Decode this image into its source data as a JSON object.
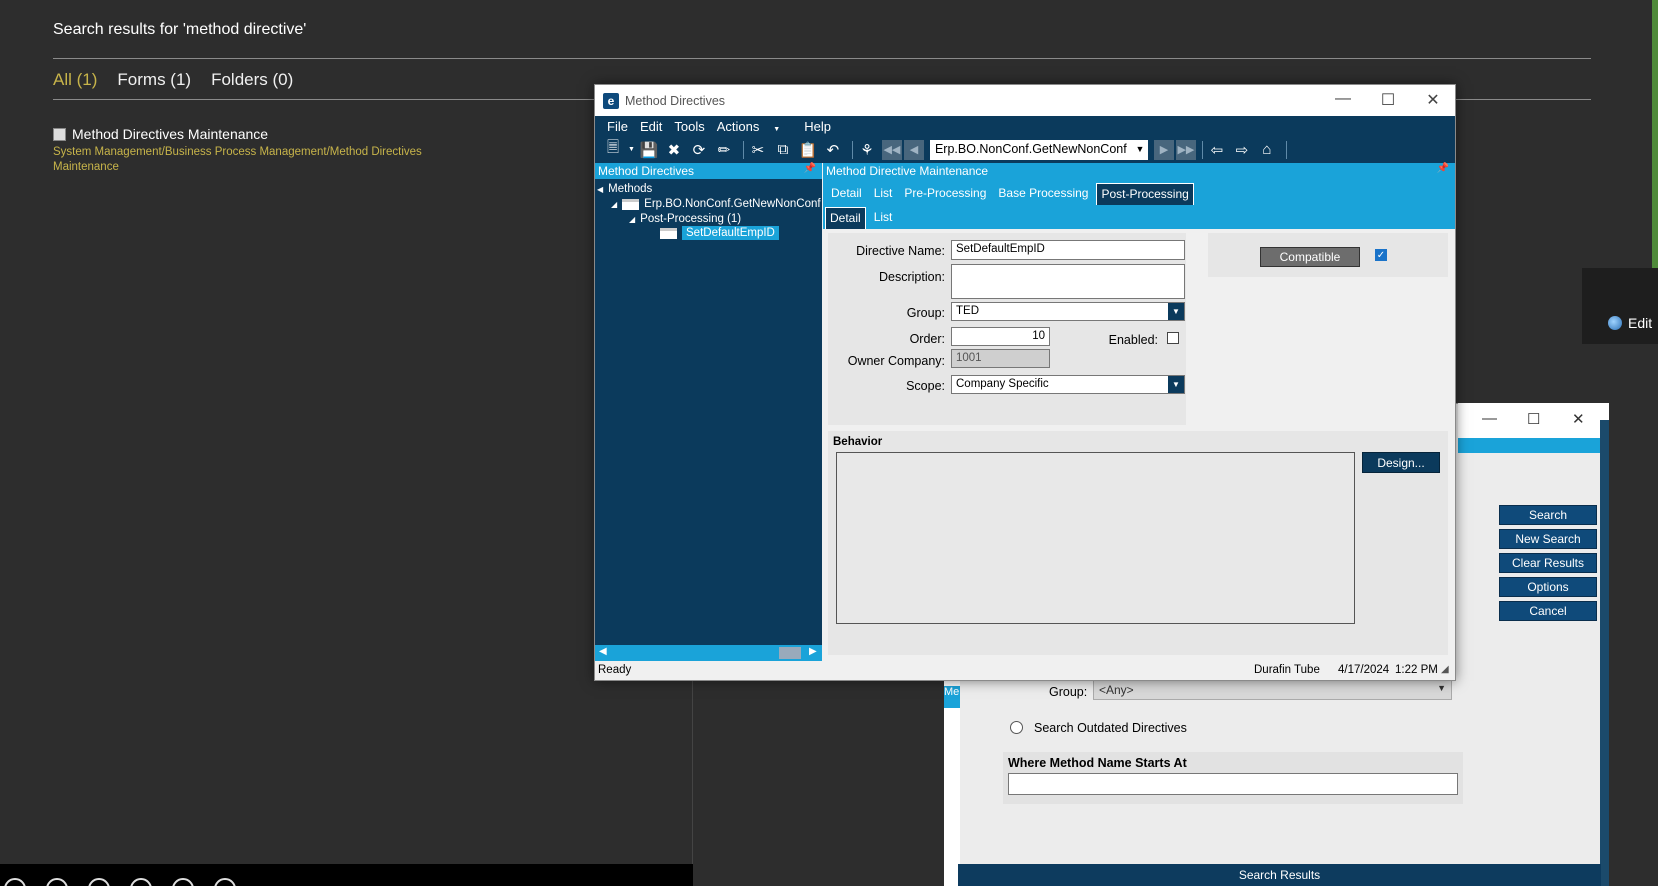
{
  "search_page": {
    "heading": "Search results for 'method directive'",
    "tabs": [
      "All (1)",
      "Forms (1)",
      "Folders (0)"
    ],
    "result_title": "Method Directives Maintenance",
    "result_path": "System Management/Business Process Management/Method Directives Maintenance",
    "edit_label": "Edit"
  },
  "bg_window": {
    "buttons": [
      "Search",
      "New Search",
      "Clear Results",
      "Options",
      "Cancel"
    ],
    "group_label": "Group:",
    "group_value": "<Any>",
    "outdated_label": "Search Outdated Directives",
    "section_title": "Where Method Name Starts At",
    "results_label": "Search Results",
    "side_tab": "Me"
  },
  "window": {
    "title": "Method Directives",
    "menu": [
      "File",
      "Edit",
      "Tools",
      "Actions",
      "Help"
    ],
    "record_combo": "Erp.BO.NonConf.GetNewNonConf",
    "tree_panel_title": "Method Directives",
    "tree": {
      "root": "Methods",
      "method": "Erp.BO.NonConf.GetNewNonConf",
      "group": "Post-Processing (1)",
      "item": "SetDefaultEmpID"
    },
    "maint_title": "Method Directive Maintenance",
    "tabs": [
      "Detail",
      "List",
      "Pre-Processing",
      "Base Processing",
      "Post-Processing"
    ],
    "subtabs": [
      "Detail",
      "List"
    ],
    "form": {
      "directive_name_label": "Directive Name:",
      "directive_name": "SetDefaultEmpID",
      "description_label": "Description:",
      "description": "",
      "group_label": "Group:",
      "group": "TED",
      "order_label": "Order:",
      "order": "10",
      "enabled_label": "Enabled:",
      "enabled": false,
      "owner_company_label": "Owner Company:",
      "owner_company": "1001",
      "scope_label": "Scope:",
      "scope": "Company Specific",
      "compatible_label": "Compatible",
      "compatible": true
    },
    "behavior_label": "Behavior",
    "design_button": "Design...",
    "status": {
      "left": "Ready",
      "company": "Durafin Tube",
      "date": "4/17/2024",
      "time": "1:22 PM"
    }
  },
  "colors": {
    "navy": "#0b3a5c",
    "cyan": "#1aa3d9",
    "gold": "#c7b44a"
  }
}
